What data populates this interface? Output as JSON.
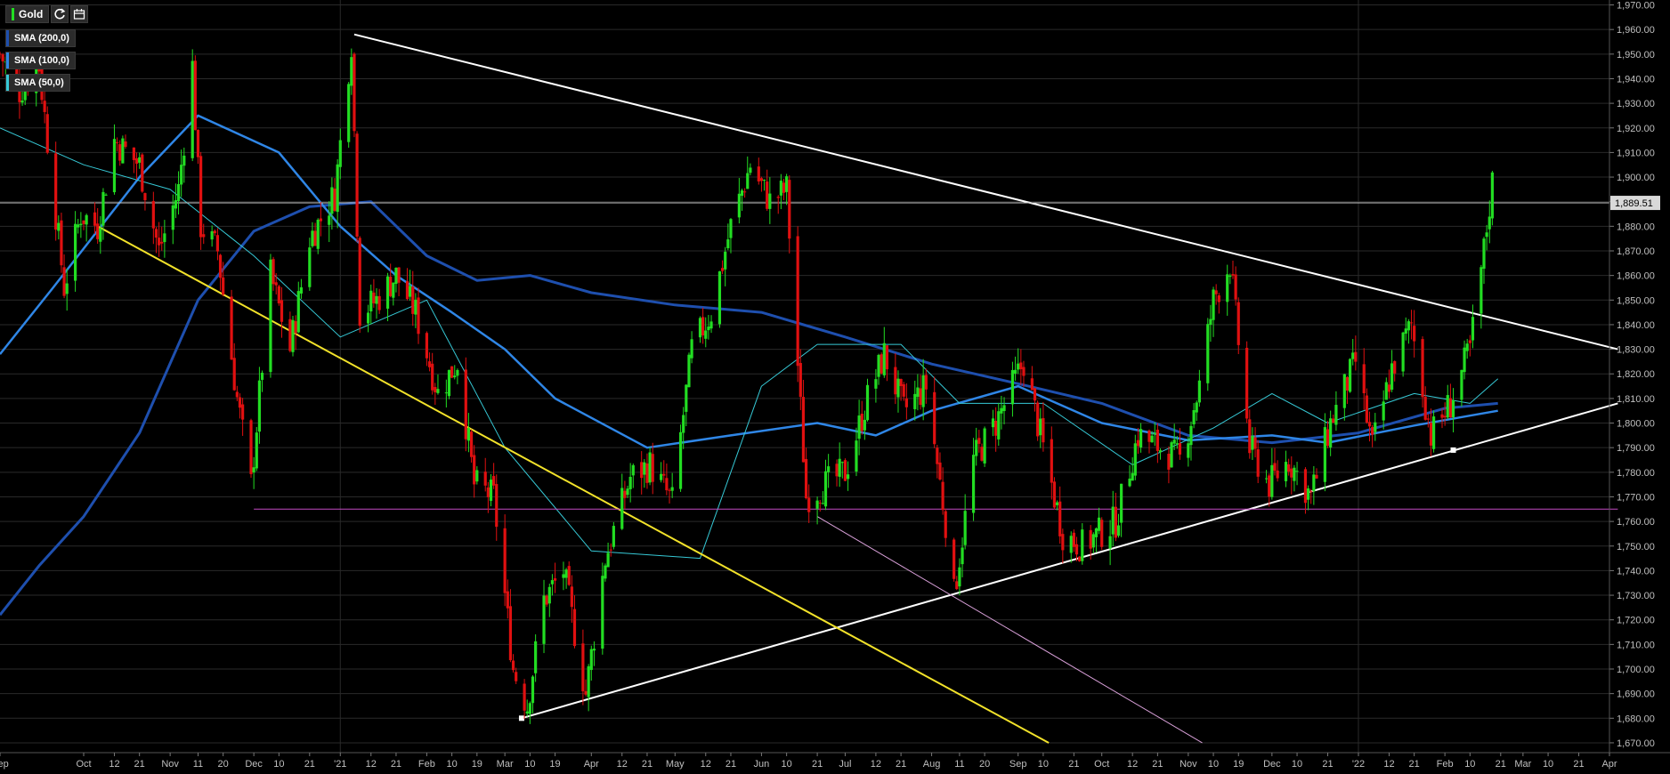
{
  "symbol": "Gold",
  "toolbar": {
    "refresh_icon": "refresh-icon",
    "calendar_icon": "calendar-icon"
  },
  "indicators": [
    {
      "label": "SMA (200,0)",
      "color": "#1e4fae"
    },
    {
      "label": "SMA (100,0)",
      "color": "#2f86e6"
    },
    {
      "label": "SMA (50,0)",
      "color": "#36c9d6"
    }
  ],
  "price_tag": "1,889.51",
  "colors": {
    "up": "#22dd22",
    "down": "#e01010",
    "background": "#000000",
    "grid": "#2a2a2a",
    "yellow_trendline": "#f2e22a",
    "white_trendline": "#ffffff",
    "magenta_level": "#c34bc3",
    "pink_channel": "#d9a0d9",
    "price_line": "#c8c8c8"
  },
  "chart_data": {
    "type": "candlestick",
    "y_axis": {
      "ticks": [
        "1,670.00",
        "1,680.00",
        "1,690.00",
        "1,700.00",
        "1,710.00",
        "1,720.00",
        "1,730.00",
        "1,740.00",
        "1,750.00",
        "1,760.00",
        "1,770.00",
        "1,780.00",
        "1,790.00",
        "1,800.00",
        "1,810.00",
        "1,820.00",
        "1,830.00",
        "1,840.00",
        "1,850.00",
        "1,860.00",
        "1,870.00",
        "1,880.00",
        "1,890.00",
        "1,900.00",
        "1,910.00",
        "1,920.00",
        "1,930.00",
        "1,940.00",
        "1,950.00",
        "1,960.00",
        "1,970.00"
      ],
      "range": [
        1666,
        1972
      ]
    },
    "x_axis": {
      "ticks": [
        {
          "label": "Sep",
          "date": "2020-09-01"
        },
        {
          "label": "Oct",
          "date": "2020-10-01"
        },
        {
          "label": "12",
          "date": "2020-10-12"
        },
        {
          "label": "21",
          "date": "2020-10-21"
        },
        {
          "label": "Nov",
          "date": "2020-11-01"
        },
        {
          "label": "11",
          "date": "2020-11-11"
        },
        {
          "label": "20",
          "date": "2020-11-20"
        },
        {
          "label": "Dec",
          "date": "2020-12-01"
        },
        {
          "label": "10",
          "date": "2020-12-10"
        },
        {
          "label": "21",
          "date": "2020-12-21"
        },
        {
          "label": "'21",
          "date": "2021-01-01"
        },
        {
          "label": "12",
          "date": "2021-01-12"
        },
        {
          "label": "21",
          "date": "2021-01-21"
        },
        {
          "label": "Feb",
          "date": "2021-02-01"
        },
        {
          "label": "10",
          "date": "2021-02-10"
        },
        {
          "label": "19",
          "date": "2021-02-19"
        },
        {
          "label": "Mar",
          "date": "2021-03-01"
        },
        {
          "label": "10",
          "date": "2021-03-10"
        },
        {
          "label": "19",
          "date": "2021-03-19"
        },
        {
          "label": "Apr",
          "date": "2021-04-01"
        },
        {
          "label": "12",
          "date": "2021-04-12"
        },
        {
          "label": "21",
          "date": "2021-04-21"
        },
        {
          "label": "May",
          "date": "2021-05-01"
        },
        {
          "label": "12",
          "date": "2021-05-12"
        },
        {
          "label": "21",
          "date": "2021-05-21"
        },
        {
          "label": "Jun",
          "date": "2021-06-01"
        },
        {
          "label": "10",
          "date": "2021-06-10"
        },
        {
          "label": "21",
          "date": "2021-06-21"
        },
        {
          "label": "Jul",
          "date": "2021-07-01"
        },
        {
          "label": "12",
          "date": "2021-07-12"
        },
        {
          "label": "21",
          "date": "2021-07-21"
        },
        {
          "label": "Aug",
          "date": "2021-08-01"
        },
        {
          "label": "11",
          "date": "2021-08-11"
        },
        {
          "label": "20",
          "date": "2021-08-20"
        },
        {
          "label": "Sep",
          "date": "2021-09-01"
        },
        {
          "label": "10",
          "date": "2021-09-10"
        },
        {
          "label": "21",
          "date": "2021-09-21"
        },
        {
          "label": "Oct",
          "date": "2021-10-01"
        },
        {
          "label": "12",
          "date": "2021-10-12"
        },
        {
          "label": "21",
          "date": "2021-10-21"
        },
        {
          "label": "Nov",
          "date": "2021-11-01"
        },
        {
          "label": "10",
          "date": "2021-11-10"
        },
        {
          "label": "19",
          "date": "2021-11-19"
        },
        {
          "label": "Dec",
          "date": "2021-12-01"
        },
        {
          "label": "10",
          "date": "2021-12-10"
        },
        {
          "label": "21",
          "date": "2021-12-21"
        },
        {
          "label": "'22",
          "date": "2022-01-01"
        },
        {
          "label": "12",
          "date": "2022-01-12"
        },
        {
          "label": "21",
          "date": "2022-01-21"
        },
        {
          "label": "Feb",
          "date": "2022-02-01"
        },
        {
          "label": "10",
          "date": "2022-02-10"
        },
        {
          "label": "21",
          "date": "2022-02-21"
        },
        {
          "label": "Mar",
          "date": "2022-03-01"
        },
        {
          "label": "10",
          "date": "2022-03-10"
        },
        {
          "label": "21",
          "date": "2022-03-21"
        },
        {
          "label": "Apr",
          "date": "2022-04-01"
        }
      ],
      "range": [
        "2020-09-01",
        "2022-04-01"
      ]
    },
    "vertical_grid_dates": [
      "2021-01-01",
      "2022-01-01"
    ],
    "close_path": [
      [
        "2020-09-01",
        1950
      ],
      [
        "2020-09-08",
        1935
      ],
      [
        "2020-09-15",
        1945
      ],
      [
        "2020-09-24",
        1855
      ],
      [
        "2020-09-30",
        1885
      ],
      [
        "2020-10-06",
        1880
      ],
      [
        "2020-10-12",
        1915
      ],
      [
        "2020-10-21",
        1905
      ],
      [
        "2020-10-28",
        1870
      ],
      [
        "2020-11-04",
        1895
      ],
      [
        "2020-11-09",
        1945
      ],
      [
        "2020-11-12",
        1880
      ],
      [
        "2020-11-18",
        1870
      ],
      [
        "2020-11-25",
        1810
      ],
      [
        "2020-11-30",
        1775
      ],
      [
        "2020-12-07",
        1860
      ],
      [
        "2020-12-14",
        1830
      ],
      [
        "2020-12-21",
        1875
      ],
      [
        "2020-12-30",
        1893
      ],
      [
        "2021-01-05",
        1955
      ],
      [
        "2021-01-08",
        1845
      ],
      [
        "2021-01-14",
        1850
      ],
      [
        "2021-01-21",
        1860
      ],
      [
        "2021-01-28",
        1845
      ],
      [
        "2021-02-05",
        1812
      ],
      [
        "2021-02-12",
        1825
      ],
      [
        "2021-02-18",
        1775
      ],
      [
        "2021-02-25",
        1770
      ],
      [
        "2021-03-04",
        1700
      ],
      [
        "2021-03-09",
        1685
      ],
      [
        "2021-03-15",
        1728
      ],
      [
        "2021-03-22",
        1740
      ],
      [
        "2021-03-30",
        1690
      ],
      [
        "2021-04-06",
        1745
      ],
      [
        "2021-04-15",
        1778
      ],
      [
        "2021-04-22",
        1783
      ],
      [
        "2021-04-30",
        1768
      ],
      [
        "2021-05-07",
        1830
      ],
      [
        "2021-05-14",
        1845
      ],
      [
        "2021-05-21",
        1880
      ],
      [
        "2021-05-28",
        1905
      ],
      [
        "2021-06-04",
        1890
      ],
      [
        "2021-06-10",
        1895
      ],
      [
        "2021-06-17",
        1770
      ],
      [
        "2021-06-24",
        1775
      ],
      [
        "2021-07-01",
        1780
      ],
      [
        "2021-07-09",
        1810
      ],
      [
        "2021-07-15",
        1828
      ],
      [
        "2021-07-22",
        1805
      ],
      [
        "2021-07-30",
        1815
      ],
      [
        "2021-08-06",
        1760
      ],
      [
        "2021-08-09",
        1730
      ],
      [
        "2021-08-16",
        1785
      ],
      [
        "2021-08-24",
        1800
      ],
      [
        "2021-09-03",
        1825
      ],
      [
        "2021-09-10",
        1790
      ],
      [
        "2021-09-17",
        1755
      ],
      [
        "2021-09-24",
        1750
      ],
      [
        "2021-09-30",
        1755
      ],
      [
        "2021-10-06",
        1760
      ],
      [
        "2021-10-14",
        1795
      ],
      [
        "2021-10-22",
        1790
      ],
      [
        "2021-10-29",
        1785
      ],
      [
        "2021-11-05",
        1815
      ],
      [
        "2021-11-10",
        1850
      ],
      [
        "2021-11-16",
        1865
      ],
      [
        "2021-11-23",
        1790
      ],
      [
        "2021-11-30",
        1775
      ],
      [
        "2021-12-07",
        1785
      ],
      [
        "2021-12-15",
        1770
      ],
      [
        "2021-12-22",
        1800
      ],
      [
        "2021-12-31",
        1825
      ],
      [
        "2022-01-06",
        1790
      ],
      [
        "2022-01-13",
        1822
      ],
      [
        "2022-01-20",
        1840
      ],
      [
        "2022-01-27",
        1795
      ],
      [
        "2022-02-03",
        1808
      ],
      [
        "2022-02-10",
        1830
      ],
      [
        "2022-02-15",
        1870
      ],
      [
        "2022-02-18",
        1898
      ]
    ],
    "sma_200_path": [
      [
        "2020-09-01",
        1722
      ],
      [
        "2020-09-15",
        1742
      ],
      [
        "2020-10-01",
        1762
      ],
      [
        "2020-10-21",
        1796
      ],
      [
        "2020-11-11",
        1850
      ],
      [
        "2020-12-01",
        1878
      ],
      [
        "2020-12-21",
        1888
      ],
      [
        "2021-01-12",
        1890
      ],
      [
        "2021-02-01",
        1868
      ],
      [
        "2021-02-19",
        1858
      ],
      [
        "2021-03-10",
        1860
      ],
      [
        "2021-04-01",
        1853
      ],
      [
        "2021-05-01",
        1848
      ],
      [
        "2021-06-01",
        1845
      ],
      [
        "2021-07-01",
        1835
      ],
      [
        "2021-08-01",
        1824
      ],
      [
        "2021-09-01",
        1816
      ],
      [
        "2021-10-01",
        1808
      ],
      [
        "2021-11-01",
        1795
      ],
      [
        "2021-12-01",
        1792
      ],
      [
        "2022-01-01",
        1796
      ],
      [
        "2022-02-01",
        1806
      ],
      [
        "2022-02-20",
        1808
      ]
    ],
    "sma_100_path": [
      [
        "2020-09-01",
        1828
      ],
      [
        "2020-09-20",
        1855
      ],
      [
        "2020-10-21",
        1900
      ],
      [
        "2020-11-11",
        1925
      ],
      [
        "2020-12-10",
        1910
      ],
      [
        "2021-01-01",
        1880
      ],
      [
        "2021-01-21",
        1860
      ],
      [
        "2021-02-10",
        1845
      ],
      [
        "2021-03-01",
        1830
      ],
      [
        "2021-03-19",
        1810
      ],
      [
        "2021-04-21",
        1790
      ],
      [
        "2021-05-21",
        1795
      ],
      [
        "2021-06-21",
        1800
      ],
      [
        "2021-07-12",
        1795
      ],
      [
        "2021-08-01",
        1805
      ],
      [
        "2021-09-01",
        1815
      ],
      [
        "2021-10-01",
        1800
      ],
      [
        "2021-11-01",
        1793
      ],
      [
        "2021-12-01",
        1795
      ],
      [
        "2021-12-21",
        1792
      ],
      [
        "2022-01-21",
        1799
      ],
      [
        "2022-02-10",
        1803
      ],
      [
        "2022-02-20",
        1805
      ]
    ],
    "sma_50_path": [
      [
        "2020-09-01",
        1920
      ],
      [
        "2020-10-01",
        1905
      ],
      [
        "2020-11-01",
        1895
      ],
      [
        "2020-12-01",
        1868
      ],
      [
        "2021-01-01",
        1835
      ],
      [
        "2021-02-01",
        1850
      ],
      [
        "2021-03-01",
        1790
      ],
      [
        "2021-04-01",
        1748
      ],
      [
        "2021-05-10",
        1745
      ],
      [
        "2021-06-01",
        1815
      ],
      [
        "2021-06-21",
        1832
      ],
      [
        "2021-07-21",
        1832
      ],
      [
        "2021-08-11",
        1808
      ],
      [
        "2021-09-10",
        1808
      ],
      [
        "2021-10-12",
        1783
      ],
      [
        "2021-11-10",
        1798
      ],
      [
        "2021-12-01",
        1812
      ],
      [
        "2021-12-21",
        1800
      ],
      [
        "2022-01-21",
        1812
      ],
      [
        "2022-02-10",
        1808
      ],
      [
        "2022-02-20",
        1818
      ]
    ],
    "trendlines": [
      {
        "name": "white-descending-trendline",
        "from": [
          "2021-01-06",
          1958
        ],
        "to": [
          "2022-04-04",
          1830
        ]
      },
      {
        "name": "white-ascending-trendline",
        "from": [
          "2021-03-07",
          1680
        ],
        "to": [
          "2022-04-04",
          1808
        ]
      },
      {
        "name": "yellow-descending-trendline",
        "from": [
          "2020-10-06",
          1880
        ],
        "to": [
          "2021-09-12",
          1670
        ]
      },
      {
        "name": "pink-channel-line",
        "from": [
          "2021-06-21",
          1762
        ],
        "to": [
          "2021-11-06",
          1670
        ]
      },
      {
        "name": "magenta-horizontal-level",
        "from": [
          "2020-12-01",
          1765
        ],
        "to": [
          "2022-04-04",
          1765
        ]
      }
    ],
    "current_price": 1889.51
  }
}
